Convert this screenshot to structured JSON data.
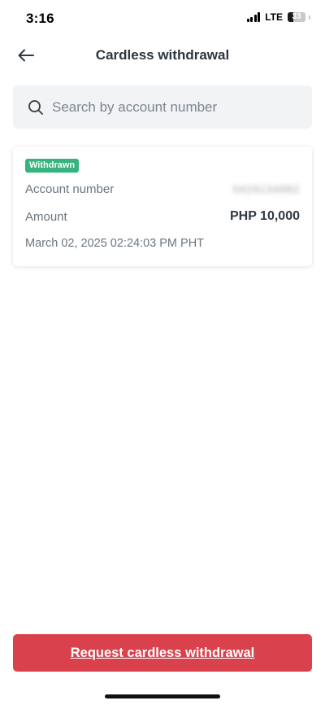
{
  "status_bar": {
    "time": "3:16",
    "network": "LTE",
    "battery_level": "33"
  },
  "header": {
    "title": "Cardless withdrawal",
    "back_icon": "arrow-left-icon"
  },
  "search": {
    "placeholder": "Search by account number",
    "value": "",
    "icon": "search-icon"
  },
  "transactions": [
    {
      "status": "Withdrawn",
      "account_label": "Account number",
      "account_value": "0429134982",
      "amount_label": "Amount",
      "amount_value": "PHP 10,000",
      "timestamp": "March 02, 2025 02:24:03 PM PHT"
    }
  ],
  "footer": {
    "cta_label": "Request cardless withdrawal"
  },
  "colors": {
    "accent": "#d9424d",
    "badge": "#36b37e",
    "search_bg": "#f2f3f5",
    "title": "#2b3640"
  }
}
